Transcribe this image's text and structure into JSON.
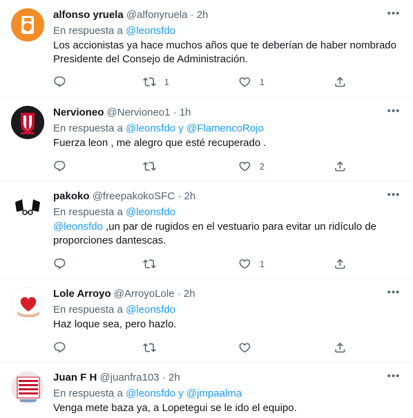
{
  "reply_prefix": "En respuesta a",
  "tweets": [
    {
      "name": "alfonso yruela",
      "handle": "@alfonyruela",
      "time": "2h",
      "reply_to_1": "@leonsfdo",
      "reply_to_and": "",
      "reply_to_2": "",
      "text_mention": "",
      "text": "Los accionistas ya hace muchos años que te deberían de haber nombrado Presidente del Consejo de Administración.",
      "retweets": "1",
      "likes": "1",
      "avatar_color": "#f28c28"
    },
    {
      "name": "Nervioneo",
      "handle": "@Nervioneo1",
      "time": "1h",
      "reply_to_1": "@leonsfdo",
      "reply_to_and": "y",
      "reply_to_2": "@FlamencoRojo",
      "text_mention": "",
      "text": "Fuerza leon , me alegro que esté recuperado .",
      "retweets": "",
      "likes": "2",
      "avatar_color": "#1a1a1a"
    },
    {
      "name": "pakoko",
      "handle": "@freepakokoSFC",
      "time": "2h",
      "reply_to_1": "@leonsfdo",
      "reply_to_and": "",
      "reply_to_2": "",
      "text_mention": "@leonsfdo",
      "text": " ,un par de rugidos en el vestuario para evitar un ridículo de proporciones dantescas.",
      "retweets": "",
      "likes": "1",
      "avatar_color": "#ffffff"
    },
    {
      "name": "Lole Arroyo",
      "handle": "@ArroyoLole",
      "time": "2h",
      "reply_to_1": "@leonsfdo",
      "reply_to_and": "",
      "reply_to_2": "",
      "text_mention": "",
      "text": "Haz loque sea, pero hazlo.",
      "retweets": "",
      "likes": "",
      "avatar_color": "#ffffff"
    },
    {
      "name": "Juan F H",
      "handle": "@juanfra103",
      "time": "2h",
      "reply_to_1": "@leonsfdo",
      "reply_to_and": "y",
      "reply_to_2": "@jmpaalma",
      "text_mention": "",
      "text": "Venga mete baza ya, a Lopetegui se le ido el equipo.",
      "retweets": "",
      "likes": "",
      "avatar_color": "#c8102e"
    }
  ]
}
